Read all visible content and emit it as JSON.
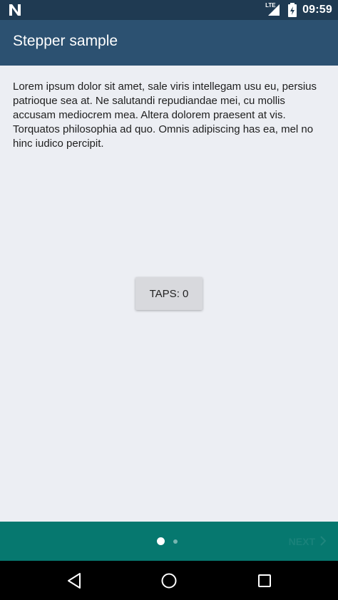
{
  "status_bar": {
    "time": "09:59",
    "network_label": "LTE",
    "icons": [
      "notification-n-icon",
      "signal-icon",
      "battery-icon"
    ]
  },
  "app_bar": {
    "title": "Stepper sample"
  },
  "content": {
    "paragraph": "Lorem ipsum dolor sit amet, sale viris intellegam usu eu, persius patrioque sea at. Ne salutandi repudiandae mei, cu mollis accusam mediocrem mea. Altera dolorem praesent at vis. Torquatos philosophia ad quo. Omnis adipiscing has ea, mel no hinc iudico percipit.",
    "taps_button_label": "TAPS: 0"
  },
  "stepper": {
    "total_steps": 2,
    "current_step": 1,
    "next_label": "NEXT"
  },
  "navigation_bar": {
    "buttons": [
      "back-icon",
      "home-icon",
      "recents-icon"
    ]
  },
  "colors": {
    "status_bar": "#1f3a52",
    "app_bar": "#2c5171",
    "content_background": "#eceef3",
    "bottom_bar": "#06786f"
  }
}
